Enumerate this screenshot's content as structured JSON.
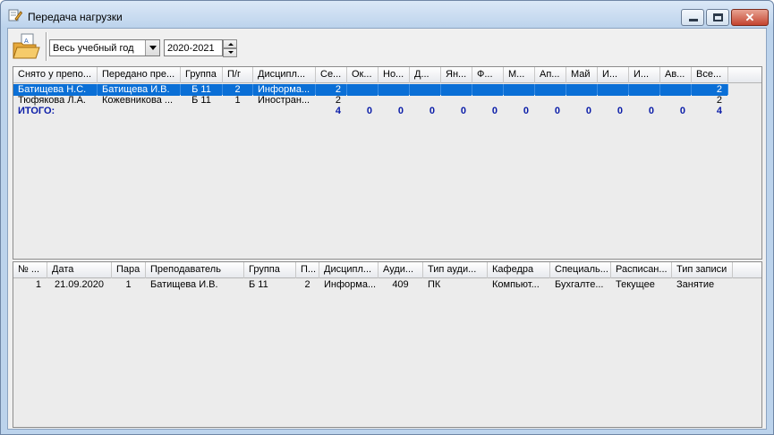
{
  "window": {
    "title": "Передача нагрузки"
  },
  "toolbar": {
    "period_value": "Весь учебный год",
    "year_value": "2020-2021"
  },
  "grid1": {
    "columns": [
      "Снято у препо...",
      "Передано пре...",
      "Группа",
      "П/г",
      "Дисципл...",
      "Се...",
      "Ок...",
      "Но...",
      "Д...",
      "Ян...",
      "Ф...",
      "М...",
      "Ап...",
      "Май",
      "И...",
      "И...",
      "Ав...",
      "Все..."
    ],
    "rows": [
      [
        "Батищева Н.С.",
        "Батищева И.В.",
        "Б 11",
        "2",
        "Информа...",
        "2",
        "",
        "",
        "",
        "",
        "",
        "",
        "",
        "",
        "",
        "",
        "",
        "2"
      ],
      [
        "Тюфякова Л.А.",
        "Кожевникова ...",
        "Б 11",
        "1",
        "Иностран...",
        "2",
        "",
        "",
        "",
        "",
        "",
        "",
        "",
        "",
        "",
        "",
        "",
        "2"
      ]
    ],
    "total": [
      "ИТОГО:",
      "",
      "",
      "",
      "",
      "4",
      "0",
      "0",
      "0",
      "0",
      "0",
      "0",
      "0",
      "0",
      "0",
      "0",
      "0",
      "4"
    ]
  },
  "grid2": {
    "columns": [
      "№ ...",
      "Дата",
      "Пара",
      "Преподаватель",
      "Группа",
      "П...",
      "Дисципл...",
      "Ауди...",
      "Тип ауди...",
      "Кафедра",
      "Специаль...",
      "Расписан...",
      "Тип записи"
    ],
    "rows": [
      [
        "1",
        "21.09.2020",
        "1",
        "Батищева И.В.",
        "Б 11",
        "2",
        "Информа...",
        "409",
        "ПК",
        "Компьют...",
        "Бухгалте...",
        "Текущее",
        "Занятие"
      ]
    ]
  }
}
